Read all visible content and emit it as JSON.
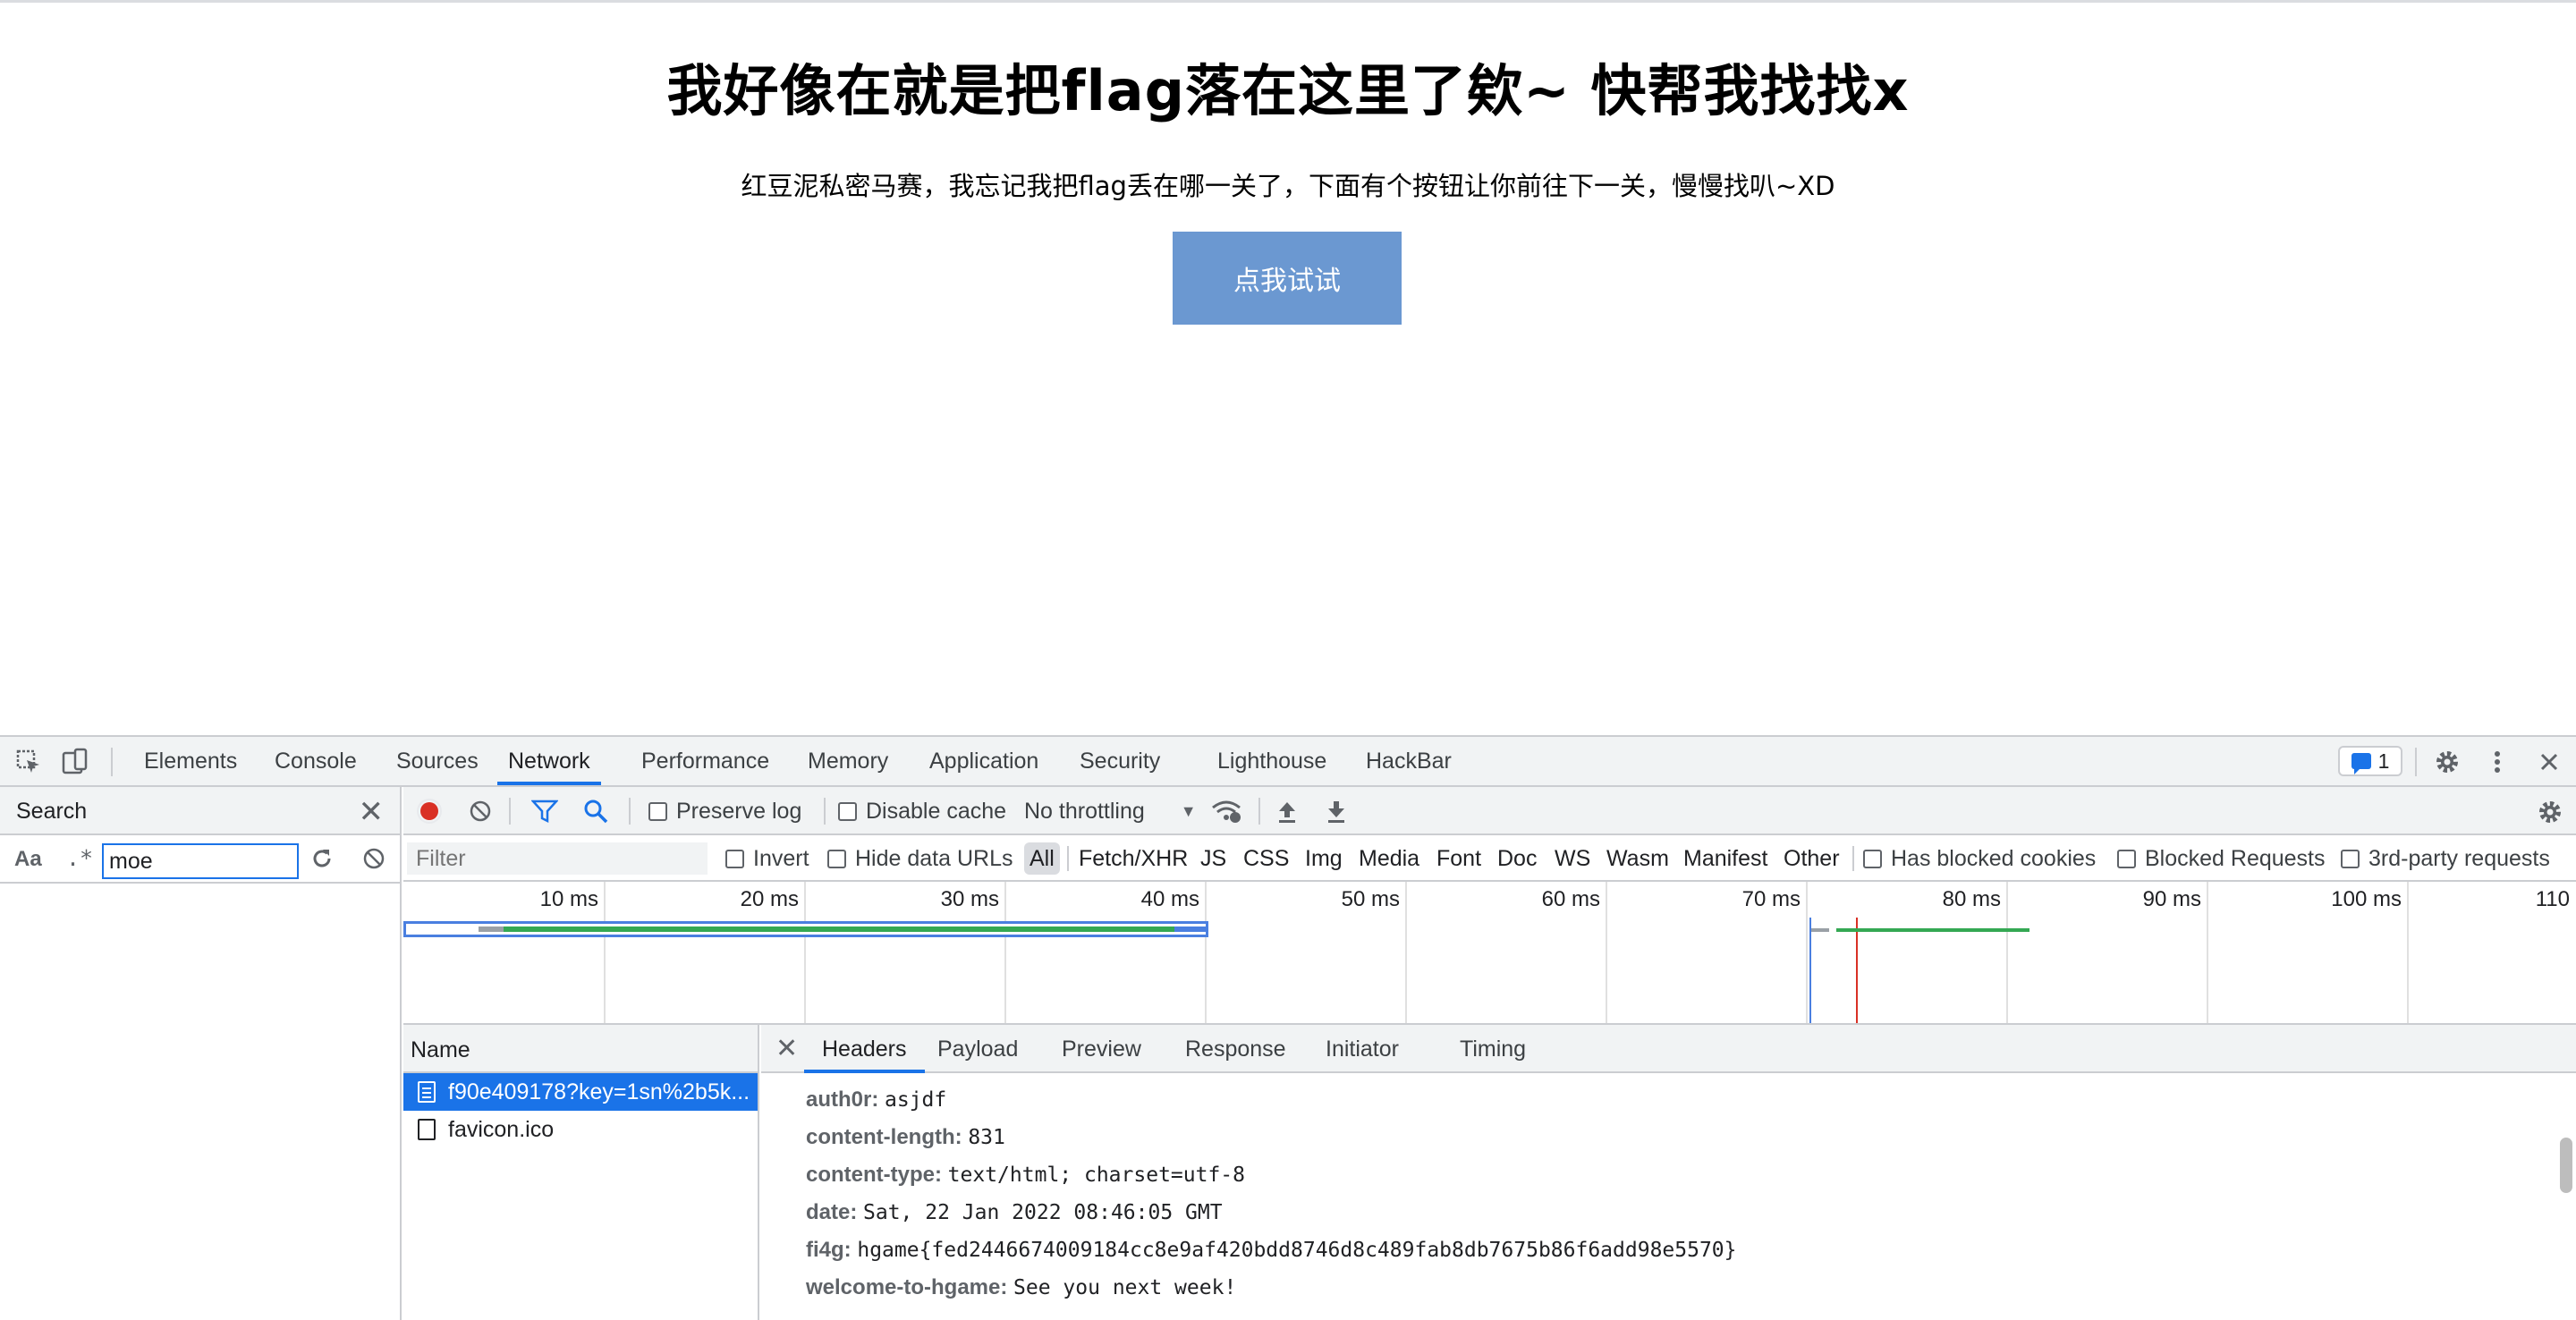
{
  "page": {
    "title": "我好像在就是把flag落在这里了欸~ 快帮我找找x",
    "description": "红豆泥私密马赛，我忘记我把flag丢在哪一关了，下面有个按钮让你前往下一关，慢慢找叭~XD",
    "button_label": "点我试试"
  },
  "devtools": {
    "tabs": [
      "Elements",
      "Console",
      "Sources",
      "Network",
      "Performance",
      "Memory",
      "Application",
      "Security",
      "Lighthouse",
      "HackBar"
    ],
    "active_tab": "Network",
    "issues_count": "1",
    "search": {
      "title": "Search",
      "case_toggle": "Aa",
      "regex_toggle": ".*",
      "query": "moe"
    },
    "network_toolbar": {
      "preserve_log": "Preserve log",
      "disable_cache": "Disable cache",
      "throttling": "No throttling"
    },
    "filter": {
      "placeholder": "Filter",
      "invert": "Invert",
      "hide_data_urls": "Hide data URLs",
      "types": [
        "All",
        "Fetch/XHR",
        "JS",
        "CSS",
        "Img",
        "Media",
        "Font",
        "Doc",
        "WS",
        "Wasm",
        "Manifest",
        "Other"
      ],
      "has_blocked_cookies": "Has blocked cookies",
      "blocked_requests": "Blocked Requests",
      "third_party": "3rd-party requests"
    },
    "timeline": {
      "ticks": [
        "10 ms",
        "20 ms",
        "30 ms",
        "40 ms",
        "50 ms",
        "60 ms",
        "70 ms",
        "80 ms",
        "90 ms",
        "100 ms",
        "110"
      ]
    },
    "requests": {
      "column": "Name",
      "items": [
        "f90e409178?key=1sn%2b5k...",
        "favicon.ico"
      ]
    },
    "details": {
      "tabs": [
        "Headers",
        "Payload",
        "Preview",
        "Response",
        "Initiator",
        "Timing"
      ],
      "active_tab": "Headers",
      "headers": [
        {
          "name": "auth0r:",
          "value": "asjdf"
        },
        {
          "name": "content-length:",
          "value": "831"
        },
        {
          "name": "content-type:",
          "value": "text/html; charset=utf-8"
        },
        {
          "name": "date:",
          "value": "Sat, 22 Jan 2022 08:46:05 GMT"
        },
        {
          "name": "fi4g:",
          "value": "hgame{fed2446674009184cc8e9af420bdd8746d8c489fab8db7675b86f6add98e5570}"
        },
        {
          "name": "welcome-to-hgame:",
          "value": "See you next week!"
        }
      ]
    }
  }
}
